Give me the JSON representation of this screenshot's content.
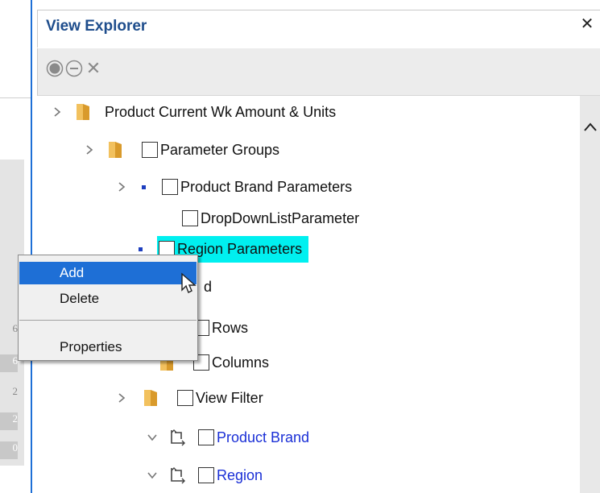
{
  "panel": {
    "title": "View Explorer",
    "close_icon": "close-icon",
    "close_glyph": "✕"
  },
  "toolbar": {
    "record_icon": "record-icon",
    "remove_icon": "minus-circle-icon",
    "clear_icon": "close-icon",
    "clear_glyph": "✕"
  },
  "background_cells": [
    "6",
    "6",
    "2",
    "2",
    "0"
  ],
  "tree": [
    {
      "label": "Product Current Wk Amount & Units",
      "icon": "folder-icon",
      "expander": "chevron-right"
    },
    {
      "label": "Parameter Groups",
      "icon": "folder-icon",
      "expander": "chevron-right",
      "checkbox": true
    },
    {
      "label": "Product Brand Parameters",
      "icon": "dot-icon",
      "expander": "chevron-right",
      "checkbox": true
    },
    {
      "label": "DropDownListParameter",
      "checkbox": true
    },
    {
      "label": "Region Parameters",
      "icon": "dot-icon",
      "checkbox": true,
      "selected": true
    },
    {
      "label": "d"
    },
    {
      "label": "Rows",
      "checkbox": true
    },
    {
      "label": "Columns",
      "icon": "folder-icon",
      "checkbox": true
    },
    {
      "label": "View Filter",
      "icon": "folder-icon",
      "expander": "chevron-right",
      "checkbox": true
    },
    {
      "label": "Product Brand",
      "icon": "pivot-icon",
      "expander": "chevron-down",
      "checkbox": true,
      "link": true
    },
    {
      "label": "Region",
      "icon": "pivot-icon",
      "expander": "chevron-down",
      "checkbox": true,
      "link": true
    }
  ],
  "context_menu": {
    "items": [
      "Add",
      "Delete",
      "Properties"
    ],
    "active": "Add"
  },
  "colors": {
    "accent": "#1e6fd6",
    "title": "#1e4d8c",
    "highlight": "#00f0f0",
    "link": "#1a2fd6"
  }
}
